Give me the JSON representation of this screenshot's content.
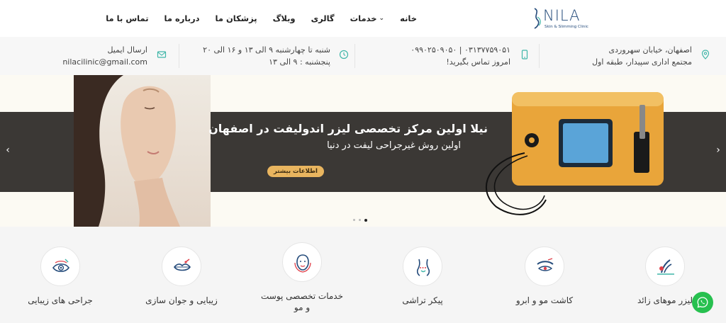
{
  "logo": {
    "text": "NILA",
    "sub": "Skin & Slimming Clinic"
  },
  "nav": {
    "items": [
      {
        "label": "خانه"
      },
      {
        "label": "خدمات"
      },
      {
        "label": "گالری"
      },
      {
        "label": "وبلاگ"
      },
      {
        "label": "پزشکان ما"
      },
      {
        "label": "درباره ما"
      },
      {
        "label": "تماس با ما"
      }
    ]
  },
  "info": {
    "address": {
      "line1": "اصفهان، خیابان سهروردی",
      "line2": "مجتمع اداری سپیدار، طبقه اول"
    },
    "phone": {
      "line1": "۰۳۱۳۷۷۵۹۰۵۱ | ۰۹۹۰۲۵۰۹۰۵۰",
      "line2": "امروز تماس بگیرید!"
    },
    "hours": {
      "line1": "شنبه تا چهارشنبه ۹ الی ۱۳ و ۱۶ الی ۲۰",
      "line2": "پنجشنبه : ۹ الی ۱۳"
    },
    "email": {
      "line1": "ارسال ایمیل",
      "line2": "nilacilinic@gmail.com"
    }
  },
  "hero": {
    "title": "نیلا اولین مرکز تخصصی لیزر اندولیفت در اصفهان",
    "subtitle": "اولین روش غیرجراحی لیفت در دنیا",
    "button": "اطلاعات بیشتر",
    "slide_count": 3,
    "active_slide": 3
  },
  "services": [
    {
      "label": "لیزر موهای زائد",
      "icon": "laser-hair-icon"
    },
    {
      "label": "کاشت مو و ابرو",
      "icon": "eyebrow-icon"
    },
    {
      "label": "پیکر تراشی",
      "icon": "body-contour-icon"
    },
    {
      "label": "خدمات تخصصی پوست و مو",
      "icon": "face-skin-icon"
    },
    {
      "label": "زیبایی و جوان سازی",
      "icon": "lips-icon"
    },
    {
      "label": "جراحی های زیبایی",
      "icon": "eye-surgery-icon"
    }
  ],
  "colors": {
    "accent": "#e9b55f",
    "brand": "#234a7a",
    "icon_teal": "#3fb6a8",
    "icon_red": "#e0414b",
    "whatsapp": "#27c04f"
  }
}
